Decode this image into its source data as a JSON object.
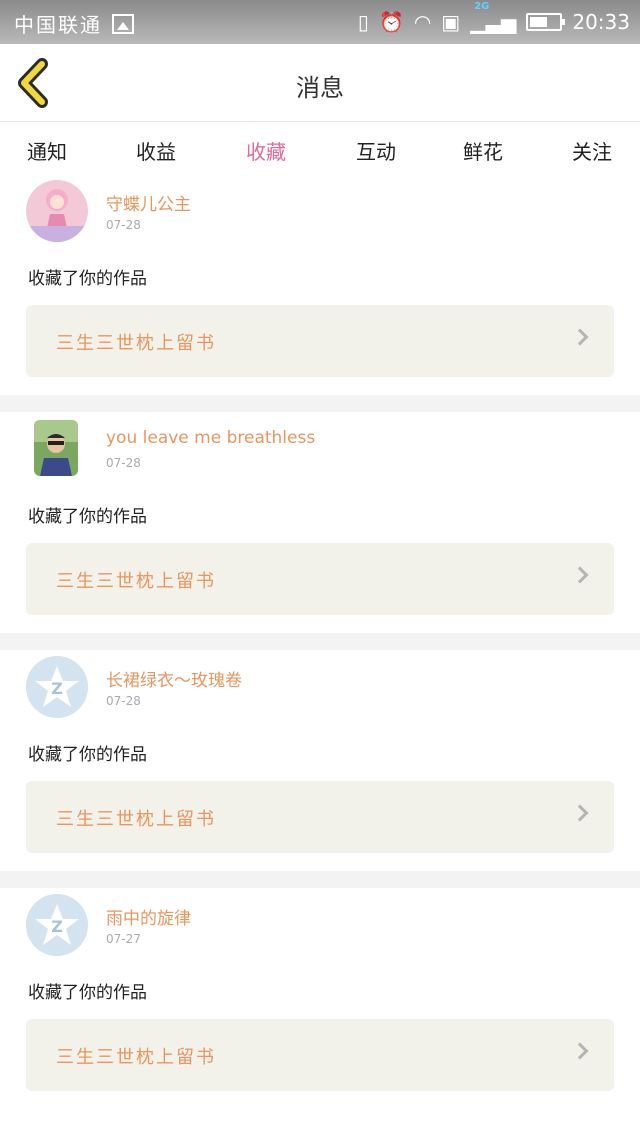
{
  "status_bar": {
    "carrier": "中国联通",
    "network_tag": "2G",
    "time": "20:33",
    "battery_level": 0.6
  },
  "header": {
    "title": "消息",
    "back_icon": "chevron-left-icon"
  },
  "tabs": [
    {
      "label": "通知",
      "active": false
    },
    {
      "label": "收益",
      "active": false
    },
    {
      "label": "收藏",
      "active": true
    },
    {
      "label": "互动",
      "active": false
    },
    {
      "label": "鲜花",
      "active": false
    },
    {
      "label": "关注",
      "active": false
    }
  ],
  "messages": [
    {
      "user": "守蝶儿公主",
      "date": "07-28",
      "text": "收藏了你的作品",
      "work": "三生三世枕上留书",
      "avatar": "photo"
    },
    {
      "user": "you leave me breathless",
      "date": "07-28",
      "text": "收藏了你的作品",
      "work": "三生三世枕上留书",
      "avatar": "photo"
    },
    {
      "user": "长裙绿衣～玫瑰卷",
      "date": "07-28",
      "text": "收藏了你的作品",
      "work": "三生三世枕上留书",
      "avatar": "default"
    },
    {
      "user": "雨中的旋律",
      "date": "07-27",
      "text": "收藏了你的作品",
      "work": "三生三世枕上留书",
      "avatar": "default"
    }
  ],
  "colors": {
    "accent_pink": "#e06a9a",
    "name_orange": "#e8965f",
    "back_yellow": "#f1d83b"
  }
}
